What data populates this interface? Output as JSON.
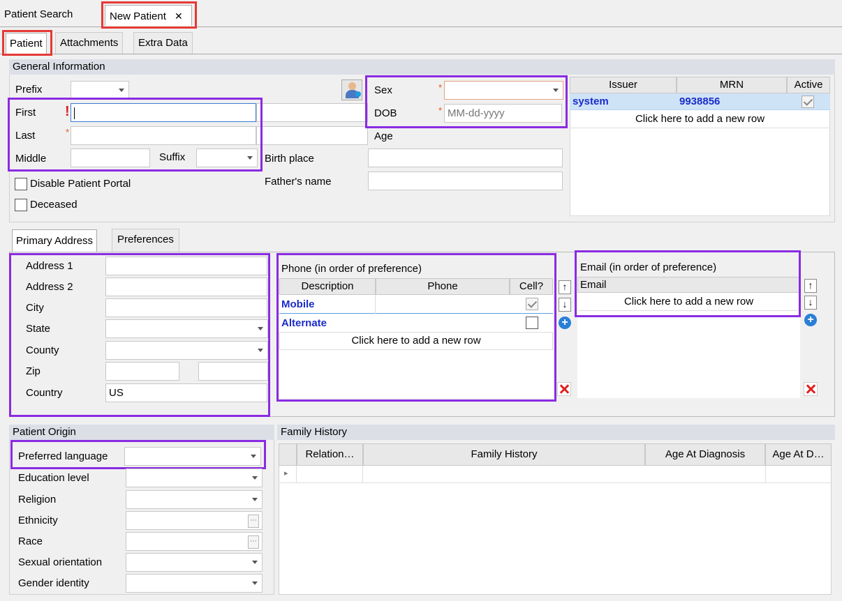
{
  "top_tabs": {
    "patient_search": "Patient Search",
    "new_patient": "New Patient",
    "close_glyph": "✕"
  },
  "sub_tabs": {
    "patient": "Patient",
    "attachments": "Attachments",
    "extra_data": "Extra Data"
  },
  "general": {
    "title": "General Information",
    "prefix_label": "Prefix",
    "first_label": "First",
    "last_label": "Last",
    "middle_label": "Middle",
    "suffix_label": "Suffix",
    "sex_label": "Sex",
    "dob_label": "DOB",
    "dob_placeholder": "MM-dd-yyyy",
    "age_label": "Age",
    "birth_place_label": "Birth place",
    "fathers_name_label": "Father's name",
    "disable_portal_label": "Disable Patient Portal",
    "deceased_label": "Deceased",
    "required_mark": "*",
    "error_mark": "!"
  },
  "mrn_grid": {
    "headers": {
      "issuer": "Issuer",
      "mrn": "MRN",
      "active": "Active"
    },
    "row": {
      "issuer": "system",
      "mrn": "9938856"
    },
    "add_row": "Click here to add a new row"
  },
  "address_tabs": {
    "primary": "Primary Address",
    "preferences": "Preferences"
  },
  "address": {
    "address1_label": "Address 1",
    "address2_label": "Address 2",
    "city_label": "City",
    "state_label": "State",
    "county_label": "County",
    "zip_label": "Zip",
    "country_label": "Country",
    "country_value": "US"
  },
  "phone": {
    "title": "Phone (in order of preference)",
    "headers": {
      "description": "Description",
      "phone": "Phone",
      "cell": "Cell?"
    },
    "rows": [
      {
        "description": "Mobile"
      },
      {
        "description": "Alternate"
      }
    ],
    "add_row": "Click here to add a new row"
  },
  "email": {
    "title": "Email (in order of preference)",
    "header": "Email",
    "add_row": "Click here to add a new row"
  },
  "buttons": {
    "up": "↑",
    "down": "↓",
    "add": "+"
  },
  "origin": {
    "title": "Patient Origin",
    "preferred_language_label": "Preferred language",
    "education_label": "Education level",
    "religion_label": "Religion",
    "ethnicity_label": "Ethnicity",
    "race_label": "Race",
    "sexual_orientation_label": "Sexual orientation",
    "gender_identity_label": "Gender identity",
    "ellipsis_btn": "⋯"
  },
  "family": {
    "title": "Family History",
    "headers": {
      "relation": "Relation…",
      "family_history": "Family History",
      "age_at_diagnosis": "Age At Diagnosis",
      "age_at_death": "Age At D…"
    },
    "row_marker": "▸"
  }
}
